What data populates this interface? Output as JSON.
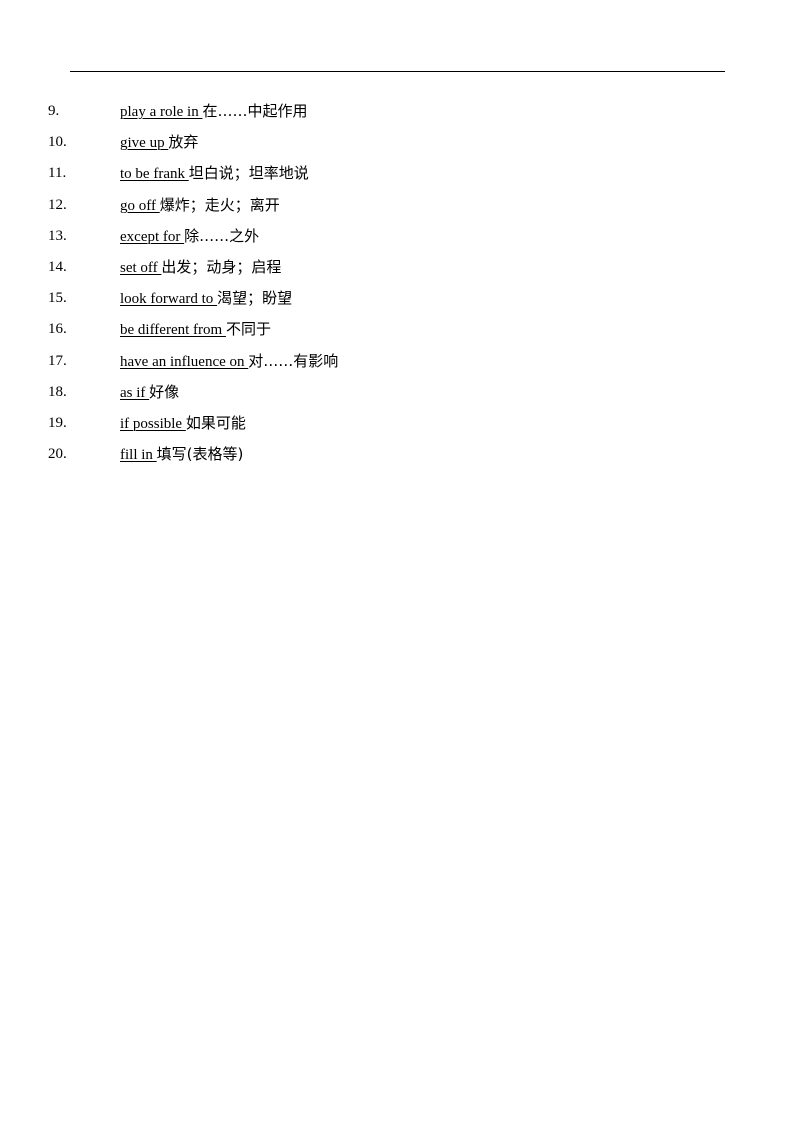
{
  "items": [
    {
      "num": "9.",
      "en": "play a role in ",
      "zh": "在……中起作用"
    },
    {
      "num": "10.",
      "en": "give up ",
      "zh": "放弃"
    },
    {
      "num": "11.",
      "en": "to be frank ",
      "zh": "坦白说；坦率地说"
    },
    {
      "num": "12.",
      "en": "go off ",
      "zh": "爆炸；走火；离开"
    },
    {
      "num": "13.",
      "en": "except for ",
      "zh": "除……之外"
    },
    {
      "num": "14.",
      "en": "set off ",
      "zh": "出发；动身；启程"
    },
    {
      "num": "15.",
      "en": "look forward to ",
      "zh": "渴望；盼望"
    },
    {
      "num": "16.",
      "en": "be different from ",
      "zh": "不同于"
    },
    {
      "num": "17.",
      "en": "have an influence on ",
      "zh": "对……有影响"
    },
    {
      "num": "18.",
      "en": "as if ",
      "zh": "好像"
    },
    {
      "num": "19.",
      "en": "if possible ",
      "zh": "如果可能"
    },
    {
      "num": "20.",
      "en": "fill in ",
      "zh": "填写(表格等)"
    }
  ]
}
